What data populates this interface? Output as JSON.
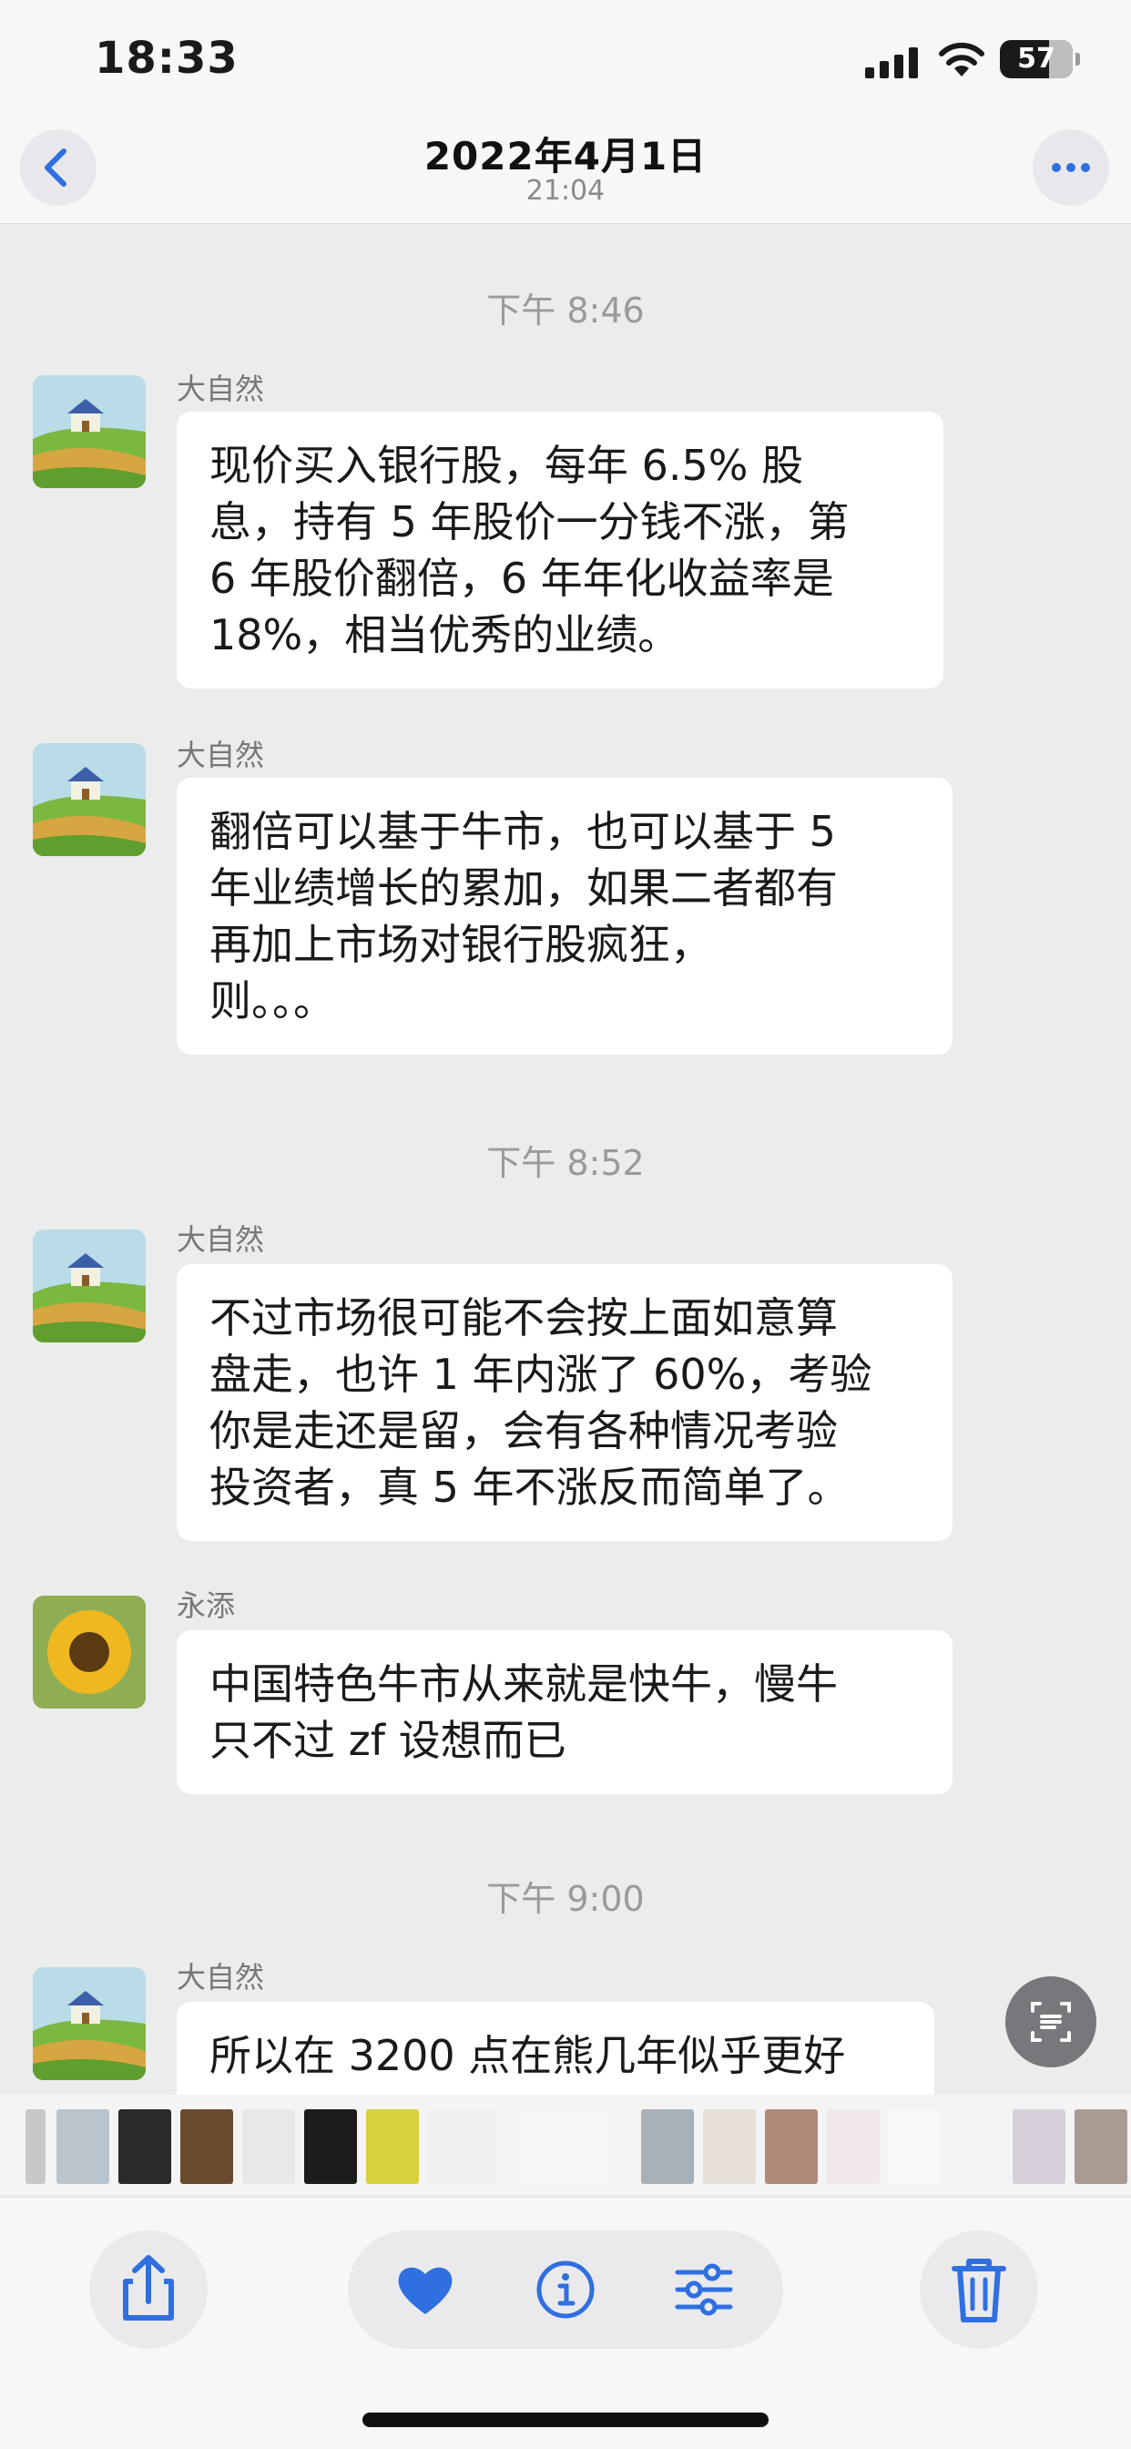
{
  "status_bar": {
    "time": "18:33",
    "battery": "57"
  },
  "header": {
    "title": "2022年4月1日",
    "subtitle": "21:04"
  },
  "icons": {
    "back": "chevron-left-icon",
    "more": "ellipsis-icon",
    "share": "share-icon",
    "favorite": "heart-icon",
    "info": "info-icon",
    "adjust": "sliders-icon",
    "delete": "trash-icon",
    "scan": "text-scan-icon"
  },
  "accent_color": "#2f6fe0",
  "chat": {
    "timestamps": [
      "下午 8:46",
      "下午 8:52",
      "下午 9:00"
    ],
    "messages": [
      {
        "sender": "大自然",
        "lines": [
          "现价买入银行股，每年 6.5% 股",
          "息，持有 5 年股价一分钱不涨，第",
          "6 年股价翻倍，6 年年化收益率是",
          "18%，相当优秀的业绩。"
        ]
      },
      {
        "sender": "大自然",
        "lines": [
          "翻倍可以基于牛市，也可以基于 5",
          "年业绩增长的累加，如果二者都有",
          "再加上市场对银行股疯狂，",
          "则。。。"
        ]
      },
      {
        "sender": "大自然",
        "lines": [
          "不过市场很可能不会按上面如意算",
          "盘走，也许 1 年内涨了 60%，考验",
          "你是走还是留，会有各种情况考验",
          "投资者，真 5 年不涨反而简单了。"
        ]
      },
      {
        "sender": "永添",
        "lines": [
          "中国特色牛市从来就是快牛，慢牛",
          "只不过 zf 设想而已"
        ]
      },
      {
        "sender": "大自然",
        "lines": [
          "所以在 3200 点在熊几年似乎更好"
        ]
      }
    ]
  }
}
